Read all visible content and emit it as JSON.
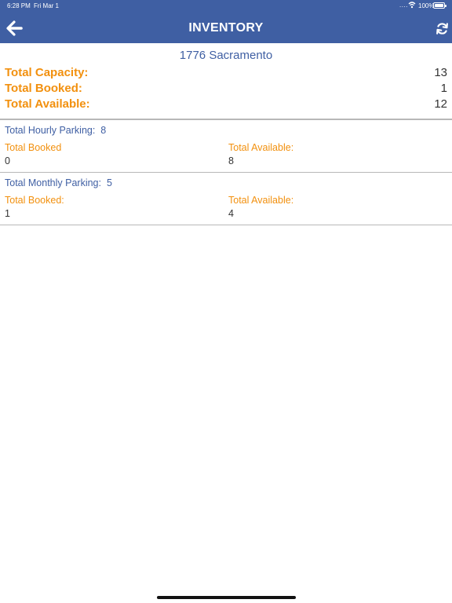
{
  "status_bar": {
    "time": "6:28 PM",
    "date": "Fri Mar 1",
    "signal": "....",
    "battery": "100%"
  },
  "header": {
    "title": "INVENTORY",
    "back_icon": "arrow-left-icon",
    "refresh_icon": "refresh-icon",
    "background_color": "#3f5fa3"
  },
  "location": {
    "name": "1776 Sacramento"
  },
  "summary": {
    "total_capacity_label": "Total Capacity:",
    "total_capacity_value": "13",
    "total_booked_label": "Total Booked:",
    "total_booked_value": "1",
    "total_available_label": "Total Available:",
    "total_available_value": "12"
  },
  "hourly": {
    "title": "Total Hourly Parking:",
    "count": "8",
    "booked_label": "Total Booked",
    "booked_value": "0",
    "available_label": "Total Available:",
    "available_value": "8"
  },
  "monthly": {
    "title": "Total Monthly Parking:",
    "count": "5",
    "booked_label": "Total Booked:",
    "booked_value": "1",
    "available_label": "Total Available:",
    "available_value": "4"
  },
  "colors": {
    "accent_blue": "#3f5fa3",
    "accent_orange": "#f2900e"
  }
}
